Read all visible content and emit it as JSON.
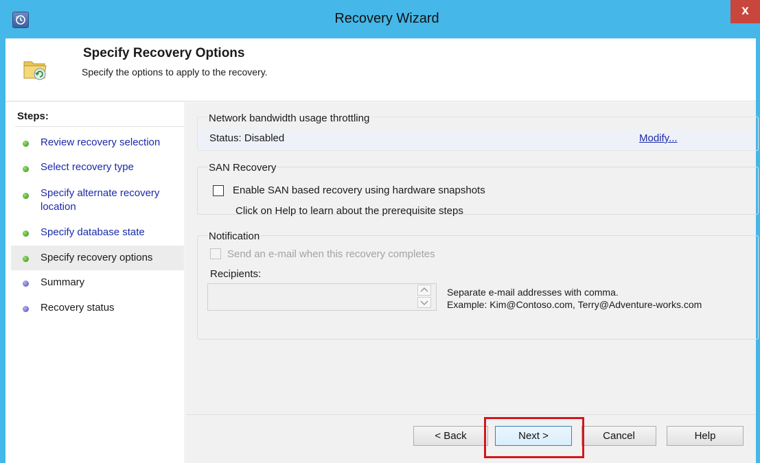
{
  "window": {
    "title": "Recovery Wizard",
    "close_label": "x"
  },
  "header": {
    "title": "Specify Recovery Options",
    "subtitle": "Specify the options to apply to the recovery."
  },
  "steps": {
    "title": "Steps:",
    "items": [
      {
        "label": "Review recovery selection",
        "state": "completed"
      },
      {
        "label": "Select recovery type",
        "state": "completed"
      },
      {
        "label": "Specify alternate recovery location",
        "state": "completed"
      },
      {
        "label": "Specify database state",
        "state": "completed"
      },
      {
        "label": "Specify recovery options",
        "state": "current"
      },
      {
        "label": "Summary",
        "state": "pending"
      },
      {
        "label": "Recovery status",
        "state": "pending"
      }
    ]
  },
  "network": {
    "group_title": "Network bandwidth usage throttling",
    "status": "Status: Disabled",
    "modify_link": "Modify..."
  },
  "san": {
    "group_title": "SAN Recovery",
    "checkbox_label": "Enable SAN based recovery using hardware snapshots",
    "checked": false,
    "help_text": "Click on Help to learn about the prerequisite steps"
  },
  "notification": {
    "group_title": "Notification",
    "checkbox_label": "Send an e-mail when this recovery completes",
    "checked": false,
    "enabled": false,
    "recipients_label": "Recipients:",
    "recipients_value": "",
    "hint_line1": "Separate e-mail addresses with comma.",
    "hint_line2": "Example: Kim@Contoso.com, Terry@Adventure-works.com"
  },
  "buttons": {
    "back": "< Back",
    "next": "Next >",
    "cancel": "Cancel",
    "help": "Help"
  },
  "colors": {
    "titlebar": "#45b7e8",
    "link": "#1a2aa8",
    "completed_dot": "#2c8a1a",
    "pending_dot": "#4e49b3",
    "highlight": "#d4161b"
  }
}
